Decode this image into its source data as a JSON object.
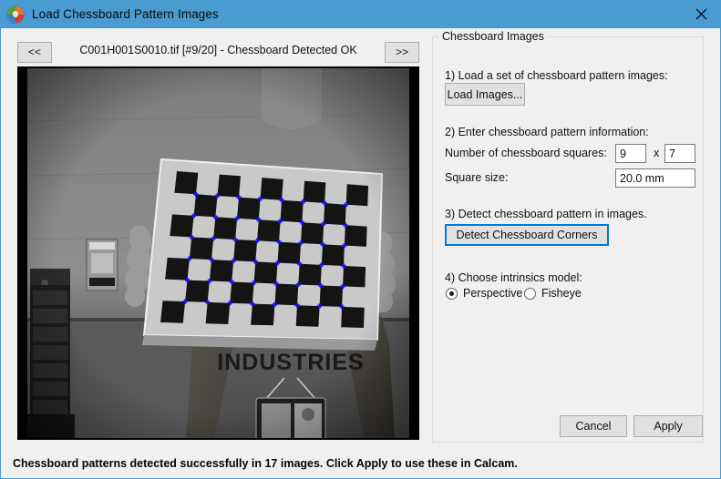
{
  "window": {
    "title": "Load Chessboard Pattern Images",
    "icon": "calcam-logo-icon",
    "close_label": "✕",
    "titlebar_color": "#4a9bd1",
    "background_color": "#f0f0f0"
  },
  "image_panel": {
    "prev_label": "<<",
    "next_label": ">>",
    "caption": "C001H001S0010.tif [#9/20] - Chessboard Detected OK",
    "image_description": "Grayscale photo of a person holding a printed chessboard calibration pattern, with blue detected corner markers overlaid",
    "marker_color": "#1414ff",
    "grid_inner_corners": {
      "cols": 8,
      "rows": 6
    }
  },
  "panel": {
    "group_title": "Chessboard Images",
    "step1_label": "1) Load a set of chessboard pattern images:",
    "load_images_label": "Load Images...",
    "step2_label": "2) Enter chessboard pattern information:",
    "squares_label": "Number of chessboard squares:",
    "squares_x_value": "9",
    "squares_separator": "x",
    "squares_y_value": "7",
    "square_size_label": "Square size:",
    "square_size_value": "20.0 mm",
    "step3_label": "3) Detect chessboard pattern in images.",
    "detect_label": "Detect Chessboard Corners",
    "detect_focus_color": "#0078d7",
    "step4_label": "4) Choose intrinsics model:",
    "intrinsics_options": [
      {
        "label": "Perspective",
        "selected": true
      },
      {
        "label": "Fisheye",
        "selected": false
      }
    ],
    "intrinsics_option_0": "Perspective",
    "intrinsics_option_1": "Fisheye"
  },
  "footer": {
    "cancel_label": "Cancel",
    "apply_label": "Apply"
  },
  "status": {
    "message": "Chessboard patterns detected successfully in 17 images. Click Apply to use these in Calcam."
  }
}
